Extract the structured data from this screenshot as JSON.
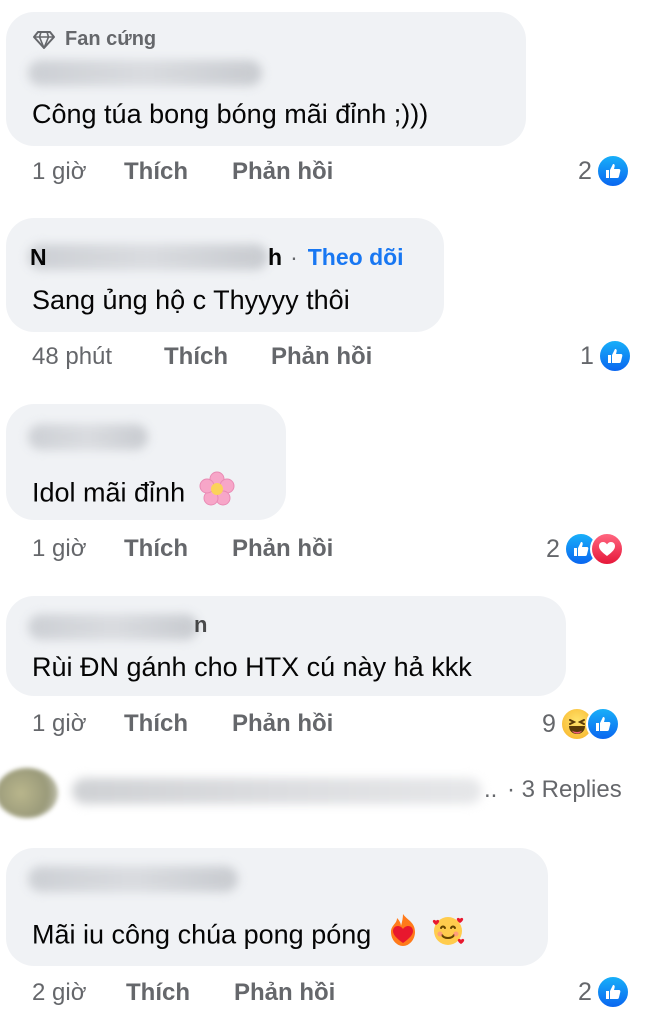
{
  "comments": [
    {
      "badge": "Fan cứng",
      "text": "Công túa bong bóng mãi đỉnh ;)))",
      "time": "1 giờ",
      "like_label": "Thích",
      "reply_label": "Phản hồi",
      "reaction_count": "2",
      "reactions": [
        "like-icon"
      ]
    },
    {
      "name_fragment_start": "N",
      "name_fragment_end": "h",
      "separator": "·",
      "follow_label": "Theo dõi",
      "text": "Sang ủng hộ c Thyyyy thôi",
      "time": "48 phút",
      "like_label": "Thích",
      "reply_label": "Phản hồi",
      "reaction_count": "1",
      "reactions": [
        "like-icon"
      ]
    },
    {
      "text": "Idol mãi đỉnh",
      "text_emoji": "flower-emoji",
      "time": "1 giờ",
      "like_label": "Thích",
      "reply_label": "Phản hồi",
      "reaction_count": "2",
      "reactions": [
        "like-icon",
        "love-icon"
      ]
    },
    {
      "name_fragment_end": "n",
      "text": "Rùi ĐN gánh cho HTX cú này hả kkk",
      "time": "1 giờ",
      "like_label": "Thích",
      "reply_label": "Phản hồi",
      "reaction_count": "9",
      "reactions": [
        "haha-icon",
        "like-icon"
      ]
    },
    {
      "text": "Mãi iu công chúa pong póng",
      "text_emoji": [
        "heart-on-fire-emoji",
        "smiling-face-with-hearts-emoji"
      ],
      "time": "2 giờ",
      "like_label": "Thích",
      "reply_label": "Phản hồi",
      "reaction_count": "2",
      "reactions": [
        "like-icon"
      ]
    }
  ],
  "replies_preview": {
    "ellipsis": "..",
    "label": "· 3 Replies"
  },
  "colors": {
    "bubble": "#f0f2f5",
    "meta_text": "#65676b",
    "follow": "#1877f2",
    "like": "#0a66f0",
    "love": "#e61739"
  }
}
